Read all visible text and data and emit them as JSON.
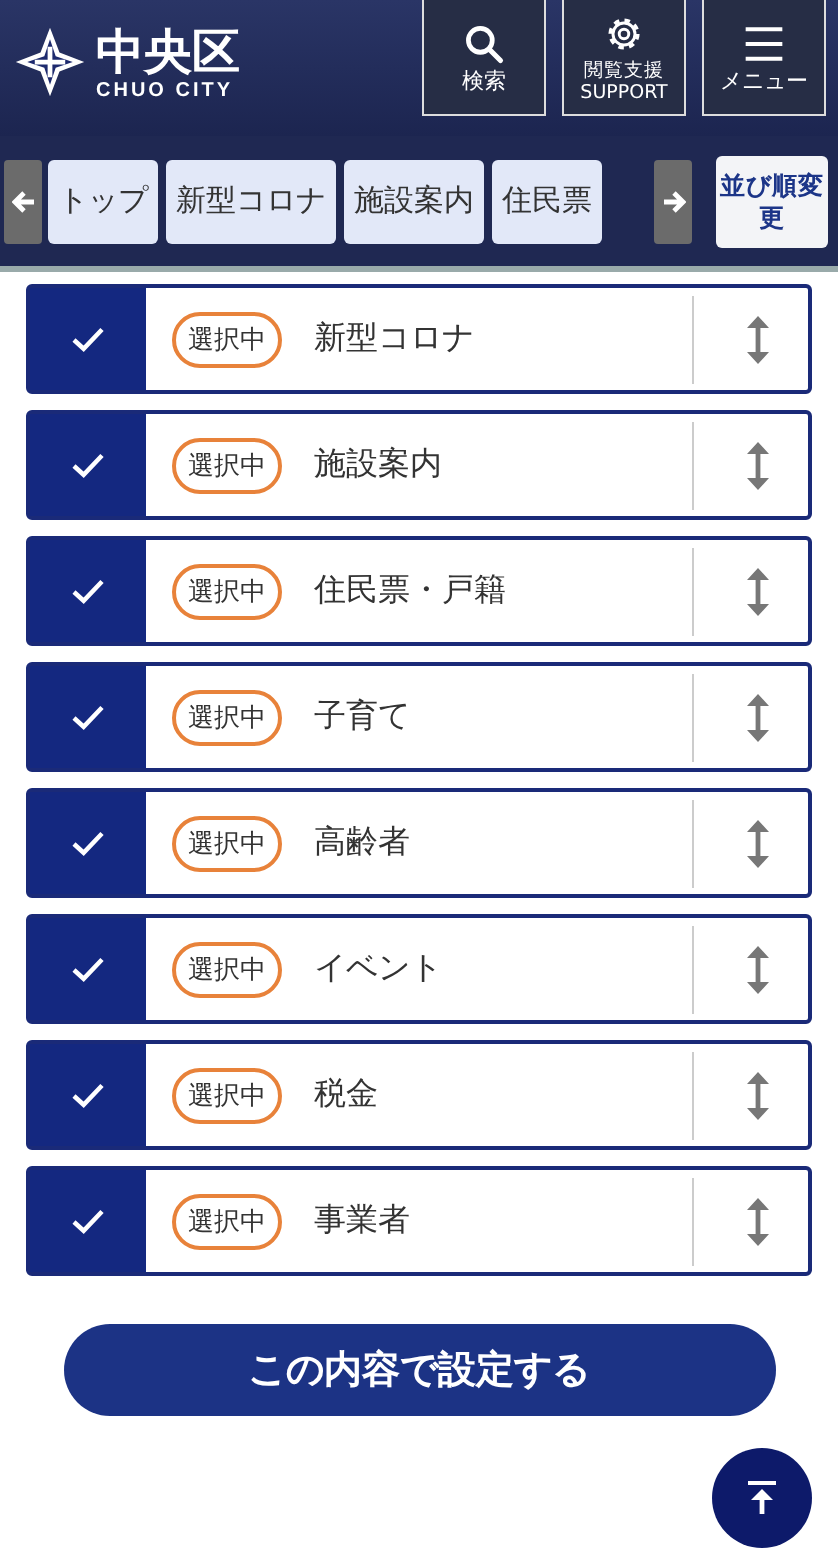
{
  "header": {
    "logo_title": "中央区",
    "logo_subtitle": "CHUO CITY",
    "buttons": [
      {
        "kind": "search",
        "label": "検索"
      },
      {
        "kind": "support",
        "label": "閲覧支援SUPPORT"
      },
      {
        "kind": "menu",
        "label": "メニュー"
      }
    ]
  },
  "tab_bar": {
    "tabs": [
      {
        "label": "トップ",
        "selected": false
      },
      {
        "label": "新型コロナ",
        "selected": false
      },
      {
        "label": "施設案内",
        "selected": false
      },
      {
        "label": "住民票",
        "selected": false
      }
    ],
    "sort_button": "並び順変更"
  },
  "items": [
    {
      "label": "新型コロナ",
      "checked": true,
      "badge": "選択中"
    },
    {
      "label": "施設案内",
      "checked": true,
      "badge": "選択中"
    },
    {
      "label": "住民票・戸籍",
      "checked": true,
      "badge": "選択中"
    },
    {
      "label": "子育て",
      "checked": true,
      "badge": "選択中"
    },
    {
      "label": "高齢者",
      "checked": true,
      "badge": "選択中"
    },
    {
      "label": "イベント",
      "checked": true,
      "badge": "選択中"
    },
    {
      "label": "税金",
      "checked": true,
      "badge": "選択中"
    },
    {
      "label": "事業者",
      "checked": true,
      "badge": "選択中"
    }
  ],
  "submit_button": "この内容で設定する"
}
